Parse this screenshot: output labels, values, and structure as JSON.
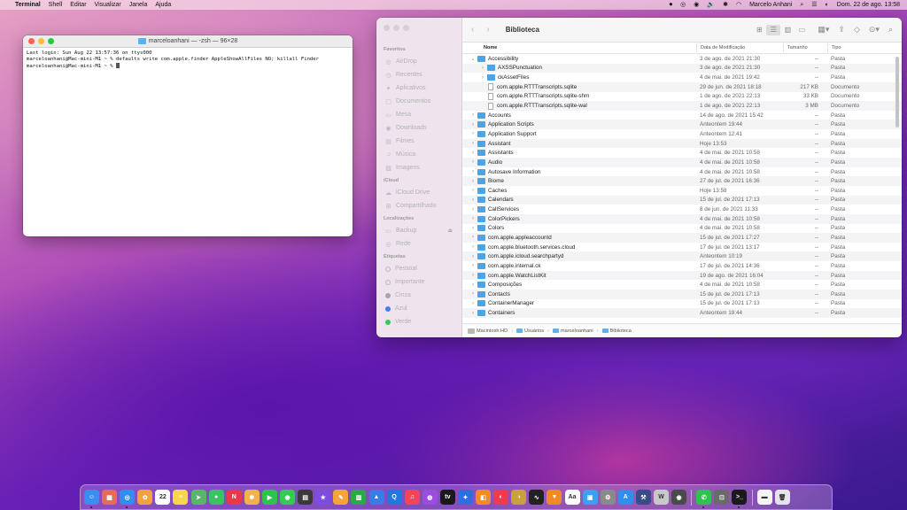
{
  "menubar": {
    "apple_icon": "apple-icon",
    "app_name": "Terminal",
    "menus": [
      "Shell",
      "Editar",
      "Visualizar",
      "Janela",
      "Ajuda"
    ],
    "user_name": "Marcelo Anhani",
    "datetime": "Dom. 22 de ago.  13:58"
  },
  "terminal": {
    "title": "marceloanhani — -zsh — 96×28",
    "lines": [
      "Last login: Sun Aug 22 13:57:36 on ttys000",
      "marceloanhani@Mac-mini-M1 ~ % defaults write com.apple.finder AppleShowAllFiles NO; killall Finder",
      "marceloanhani@Mac-mini-M1 ~ % "
    ]
  },
  "finder": {
    "title": "Biblioteca",
    "sidebar": {
      "favorites_header": "Favoritos",
      "favorites": [
        "AirDrop",
        "Recentes",
        "Aplicativos",
        "Documentos",
        "Mesa",
        "Downloads",
        "Filmes",
        "Música",
        "Imagens"
      ],
      "icloud_header": "iCloud",
      "icloud": [
        "iCloud Drive",
        "Compartilhado"
      ],
      "locations_header": "Localizações",
      "locations": [
        "Backup",
        "Rede"
      ],
      "tags_header": "Etiquetas",
      "tags": [
        {
          "label": "Pessoal",
          "color": "#e4e4e4"
        },
        {
          "label": "Importante",
          "color": "#e4e4e4"
        },
        {
          "label": "Cinza",
          "color": "#a7a7ac"
        },
        {
          "label": "Azul",
          "color": "#3b82f6"
        },
        {
          "label": "Verde",
          "color": "#34c759"
        }
      ]
    },
    "columns": {
      "name": "Nome",
      "date": "Data de Modificação",
      "size": "Tamanho",
      "kind": "Tipo"
    },
    "rows": [
      {
        "name": "Accessibility",
        "date": "3 de ago. de 2021 21:30",
        "size": "--",
        "kind": "Pasta",
        "type": "folder",
        "level": 0,
        "expanded": true
      },
      {
        "name": "AXSSPunctuation",
        "date": "3 de ago. de 2021 21:30",
        "size": "--",
        "kind": "Pasta",
        "type": "folder",
        "level": 1,
        "expanded": false
      },
      {
        "name": "ckAssetFiles",
        "date": "4 de mai. de 2021 19:42",
        "size": "--",
        "kind": "Pasta",
        "type": "folder",
        "level": 1,
        "expanded": false
      },
      {
        "name": "com.apple.RTTTranscripts.sqlite",
        "date": "29 de jun. de 2021 18:18",
        "size": "217 KB",
        "kind": "Documento",
        "type": "doc",
        "level": 1
      },
      {
        "name": "com.apple.RTTTranscripts.sqlite-shm",
        "date": "1 de ago. de 2021 22:13",
        "size": "33 KB",
        "kind": "Documento",
        "type": "doc",
        "level": 1
      },
      {
        "name": "com.apple.RTTTranscripts.sqlite-wal",
        "date": "1 de ago. de 2021 22:13",
        "size": "3 MB",
        "kind": "Documento",
        "type": "doc",
        "level": 1
      },
      {
        "name": "Accounts",
        "date": "14 de ago. de 2021 15:42",
        "size": "--",
        "kind": "Pasta",
        "type": "folder",
        "level": 0
      },
      {
        "name": "Application Scripts",
        "date": "Anteontem 19:44",
        "size": "--",
        "kind": "Pasta",
        "type": "folder",
        "level": 0
      },
      {
        "name": "Application Support",
        "date": "Anteontem 12:41",
        "size": "--",
        "kind": "Pasta",
        "type": "folder",
        "level": 0
      },
      {
        "name": "Assistant",
        "date": "Hoje 13:53",
        "size": "--",
        "kind": "Pasta",
        "type": "folder",
        "level": 0
      },
      {
        "name": "Assistants",
        "date": "4 de mai. de 2021 10:58",
        "size": "--",
        "kind": "Pasta",
        "type": "folder",
        "level": 0
      },
      {
        "name": "Audio",
        "date": "4 de mai. de 2021 10:58",
        "size": "--",
        "kind": "Pasta",
        "type": "folder",
        "level": 0
      },
      {
        "name": "Autosave Information",
        "date": "4 de mai. de 2021 10:58",
        "size": "--",
        "kind": "Pasta",
        "type": "folder",
        "level": 0
      },
      {
        "name": "Biome",
        "date": "27 de jul. de 2021 16:36",
        "size": "--",
        "kind": "Pasta",
        "type": "folder",
        "level": 0
      },
      {
        "name": "Caches",
        "date": "Hoje 13:58",
        "size": "--",
        "kind": "Pasta",
        "type": "folder",
        "level": 0
      },
      {
        "name": "Calendars",
        "date": "15 de jul. de 2021 17:13",
        "size": "--",
        "kind": "Pasta",
        "type": "folder",
        "level": 0
      },
      {
        "name": "CallServices",
        "date": "8 de jun. de 2021 11:33",
        "size": "--",
        "kind": "Pasta",
        "type": "folder",
        "level": 0
      },
      {
        "name": "ColorPickers",
        "date": "4 de mai. de 2021 10:58",
        "size": "--",
        "kind": "Pasta",
        "type": "folder",
        "level": 0
      },
      {
        "name": "Colors",
        "date": "4 de mai. de 2021 10:58",
        "size": "--",
        "kind": "Pasta",
        "type": "folder",
        "level": 0
      },
      {
        "name": "com.apple.appleaccountd",
        "date": "15 de jul. de 2021 17:27",
        "size": "--",
        "kind": "Pasta",
        "type": "folder",
        "level": 0
      },
      {
        "name": "com.apple.bluetooth.services.cloud",
        "date": "17 de jul. de 2021 13:17",
        "size": "--",
        "kind": "Pasta",
        "type": "folder",
        "level": 0
      },
      {
        "name": "com.apple.icloud.searchpartyd",
        "date": "Anteontem 10:19",
        "size": "--",
        "kind": "Pasta",
        "type": "folder",
        "level": 0
      },
      {
        "name": "com.apple.internal.ck",
        "date": "17 de jul. de 2021 14:36",
        "size": "--",
        "kind": "Pasta",
        "type": "folder",
        "level": 0
      },
      {
        "name": "com.apple.WatchListKit",
        "date": "19 de ago. de 2021 16:04",
        "size": "--",
        "kind": "Pasta",
        "type": "folder",
        "level": 0
      },
      {
        "name": "Composições",
        "date": "4 de mai. de 2021 10:58",
        "size": "--",
        "kind": "Pasta",
        "type": "folder",
        "level": 0
      },
      {
        "name": "Contacts",
        "date": "15 de jul. de 2021 17:13",
        "size": "--",
        "kind": "Pasta",
        "type": "folder",
        "level": 0
      },
      {
        "name": "ContainerManager",
        "date": "15 de jul. de 2021 17:13",
        "size": "--",
        "kind": "Pasta",
        "type": "folder",
        "level": 0
      },
      {
        "name": "Containers",
        "date": "Anteontem 19:44",
        "size": "--",
        "kind": "Pasta",
        "type": "folder",
        "level": 0
      }
    ],
    "pathbar": [
      "Macintosh HD",
      "Usuários",
      "marceloanhani",
      "Biblioteca"
    ]
  },
  "dock": {
    "apps": [
      {
        "name": "finder",
        "color": "#3a8ef0",
        "glyph": "☺",
        "running": true
      },
      {
        "name": "launchpad",
        "color": "#e86a5a",
        "glyph": "▦"
      },
      {
        "name": "safari",
        "color": "#2f8ff0",
        "glyph": "◎",
        "running": true
      },
      {
        "name": "messages-photos",
        "color": "#f2a23a",
        "glyph": "✿"
      },
      {
        "name": "calendar",
        "color": "#ffffff",
        "glyph": "22"
      },
      {
        "name": "notes",
        "color": "#f6d64c",
        "glyph": "≡"
      },
      {
        "name": "maps",
        "color": "#58b56a",
        "glyph": "➤"
      },
      {
        "name": "app-store-green",
        "color": "#3cc264",
        "glyph": "●"
      },
      {
        "name": "news",
        "color": "#e8384a",
        "glyph": "N"
      },
      {
        "name": "photos",
        "color": "#f0b24a",
        "glyph": "✾"
      },
      {
        "name": "facetime",
        "color": "#2fc24e",
        "glyph": "▶"
      },
      {
        "name": "messages",
        "color": "#36c956",
        "glyph": "◉"
      },
      {
        "name": "claquete",
        "color": "#3a3a3a",
        "glyph": "▤"
      },
      {
        "name": "imovie",
        "color": "#7c4de0",
        "glyph": "★"
      },
      {
        "name": "pages",
        "color": "#f3a43a",
        "glyph": "✎"
      },
      {
        "name": "numbers",
        "color": "#2ba84a",
        "glyph": "▥"
      },
      {
        "name": "keynote",
        "color": "#3b7be8",
        "glyph": "▲"
      },
      {
        "name": "quicktime",
        "color": "#1e78e0",
        "glyph": "Q"
      },
      {
        "name": "music",
        "color": "#f2445a",
        "glyph": "♫"
      },
      {
        "name": "podcasts",
        "color": "#9b4de0",
        "glyph": "◍"
      },
      {
        "name": "tv",
        "color": "#1a1a1a",
        "glyph": "tv"
      },
      {
        "name": "keychain",
        "color": "#2e6fe0",
        "glyph": "✦"
      },
      {
        "name": "books",
        "color": "#f38a2a",
        "glyph": "◧"
      },
      {
        "name": "news-2",
        "color": "#ef3b4e",
        "glyph": "◐"
      },
      {
        "name": "photo-booth",
        "color": "#c8a040",
        "glyph": "◑"
      },
      {
        "name": "activity-monitor",
        "color": "#222222",
        "glyph": "∿"
      },
      {
        "name": "vlc",
        "color": "#f08a24",
        "glyph": "▼"
      },
      {
        "name": "font-book",
        "color": "#ffffff",
        "glyph": "Aa"
      },
      {
        "name": "preview",
        "color": "#3c9ff0",
        "glyph": "▣"
      },
      {
        "name": "system-preferences",
        "color": "#8a8a8a",
        "glyph": "⚙"
      },
      {
        "name": "app-store",
        "color": "#2f8ff0",
        "glyph": "A"
      },
      {
        "name": "xcode",
        "color": "#3a4b8a",
        "glyph": "⚒"
      },
      {
        "name": "word",
        "color": "#c8c8c8",
        "glyph": "W"
      },
      {
        "name": "disk-utility",
        "color": "#4a4a4a",
        "glyph": "◉"
      }
    ],
    "right_apps": [
      {
        "name": "whatsapp",
        "color": "#2fc24e",
        "glyph": "✆",
        "running": true
      },
      {
        "name": "screenshot",
        "color": "#6a6a6a",
        "glyph": "⊡"
      },
      {
        "name": "terminal",
        "color": "#1a1a1a",
        "glyph": ">_",
        "running": true
      }
    ],
    "tail": [
      {
        "name": "downloads-stack",
        "color": "#f4f4f4",
        "glyph": "▬"
      },
      {
        "name": "trash",
        "color": "#e4e4ea",
        "glyph": "🗑"
      }
    ]
  }
}
